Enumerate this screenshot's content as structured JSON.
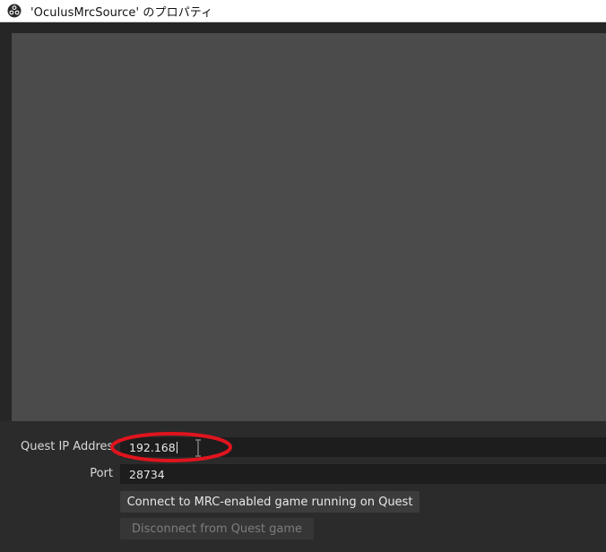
{
  "window": {
    "title": "'OculusMrcSource' のプロパティ",
    "app_icon": "obs-logo-icon"
  },
  "properties": {
    "ip_label": "Quest IP Addres",
    "ip_value": "192.168",
    "port_label": "Port",
    "port_value": "28734",
    "connect_button": "Connect to MRC-enabled game running on Quest",
    "disconnect_button": "Disconnect from Quest game"
  },
  "annotation": {
    "highlight_color": "#e0141e"
  },
  "colors": {
    "background": "#2b2b2b",
    "preview": "#4b4b4b",
    "field": "#1d1d1d",
    "button": "#3c3c3c"
  }
}
